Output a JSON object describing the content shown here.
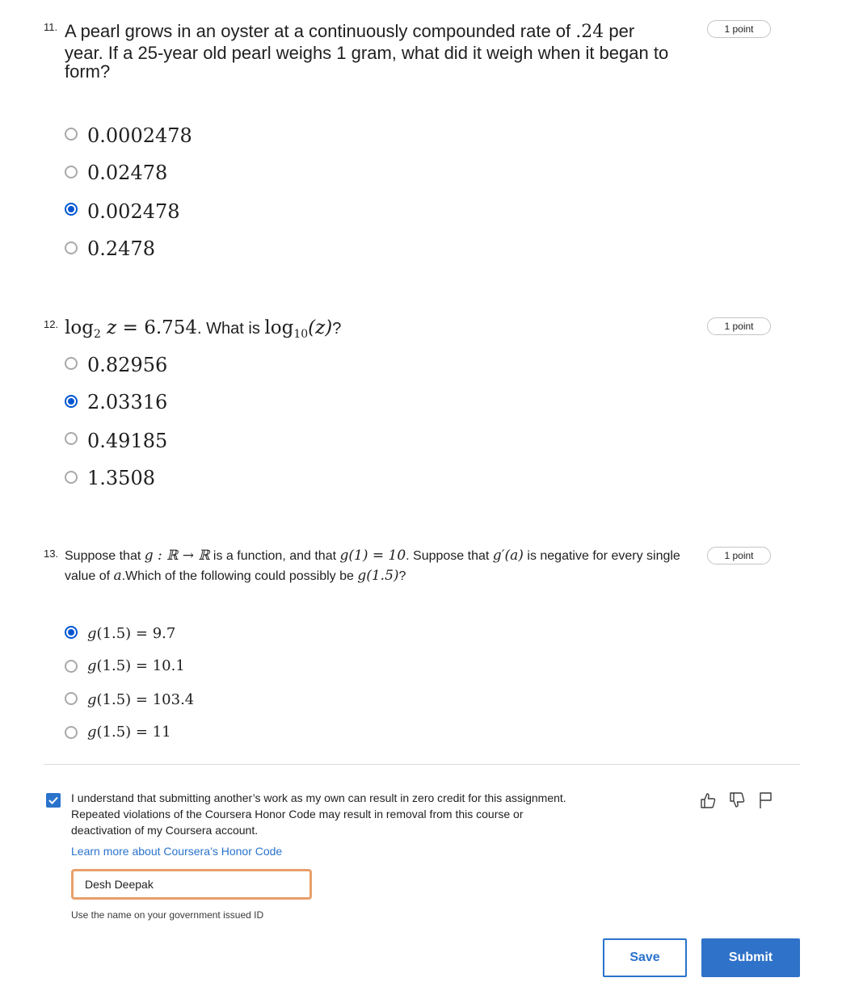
{
  "q11": {
    "number": "11.",
    "points": "1 point",
    "line1_a": "A pearl grows in an oyster at a continuously compounded rate of ",
    "line1_rate": ".24",
    "line1_b": " per",
    "line2": "year. If a 25-year old pearl weighs 1 gram, what did it weigh when it began to",
    "line3": "form?",
    "options": [
      "0.0002478",
      "0.02478",
      "0.002478",
      "0.2478"
    ],
    "selected_index": 2
  },
  "q12": {
    "number": "12.",
    "points": "1 point",
    "log": "log",
    "base2": "2",
    "var": "z",
    "eq": " = 6.754",
    "text_mid": ". What is ",
    "base10": "10",
    "arg": "(z)",
    "text_end": "?",
    "options": [
      "0.82956",
      "2.03316",
      "0.49185",
      "1.3508"
    ],
    "selected_index": 1
  },
  "q13": {
    "number": "13.",
    "points": "1 point",
    "t1": "Suppose that ",
    "m1": "g : ℝ → ℝ",
    "t2": " is a function, and that ",
    "m2": "g(1) = 10",
    "t3": ". Suppose that ",
    "m3": "g′(a)",
    "t4": " is negative for every single",
    "t5": "value of ",
    "m4": "a",
    "t6": ".Which of the following could possibly be ",
    "m5": "g(1.5)",
    "t7": "?",
    "option_fn": "g",
    "options": [
      "(1.5) = 9.7",
      "(1.5) = 10.1",
      "(1.5) = 103.4",
      "(1.5) = 11"
    ],
    "selected_index": 0
  },
  "honor": {
    "statement_l1": "I understand that submitting another’s work as my own can result in zero credit for this assignment.",
    "statement_l2": "Repeated violations of the Coursera Honor Code may result in removal from this course or",
    "statement_l3": "deactivation of my Coursera account.",
    "link": "Learn more about Coursera’s Honor Code",
    "name_value": "Desh Deepak",
    "hint": "Use the name on your government issued ID",
    "checked": true
  },
  "actions": {
    "save": "Save",
    "submit": "Submit"
  },
  "colors": {
    "accent": "#2a73cc",
    "radio_selected": "#0056d2",
    "input_focus": "#e8a06a"
  }
}
